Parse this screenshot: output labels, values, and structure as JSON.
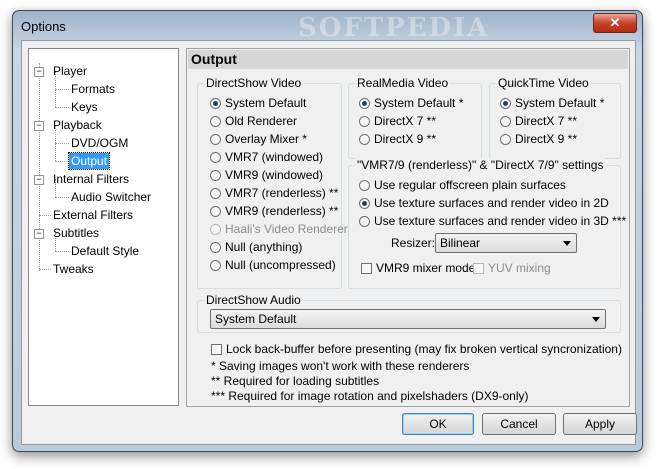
{
  "window": {
    "title": "Options",
    "watermark": "SOFTPEDIA",
    "close_glyph": "✕",
    "close_icon": "close-icon"
  },
  "tree": {
    "nodes": [
      {
        "label": "Player",
        "expanded": true
      },
      {
        "label": "Formats"
      },
      {
        "label": "Keys"
      },
      {
        "label": "Playback",
        "expanded": true
      },
      {
        "label": "DVD/OGM"
      },
      {
        "label": "Output",
        "selected": true
      },
      {
        "label": "Internal Filters",
        "expanded": true
      },
      {
        "label": "Audio Switcher"
      },
      {
        "label": "External Filters"
      },
      {
        "label": "Subtitles",
        "expanded": true
      },
      {
        "label": "Default Style"
      },
      {
        "label": "Tweaks"
      }
    ],
    "toggle_glyph": "−"
  },
  "page": {
    "title": "Output",
    "directshow_video": {
      "label": "DirectShow Video",
      "options": [
        {
          "label": "System Default",
          "checked": true
        },
        {
          "label": "Old Renderer"
        },
        {
          "label": "Overlay Mixer *"
        },
        {
          "label": "VMR7 (windowed)"
        },
        {
          "label": "VMR9 (windowed)"
        },
        {
          "label": "VMR7 (renderless) **"
        },
        {
          "label": "VMR9 (renderless) **"
        },
        {
          "label": "Haali's Video Renderer",
          "disabled": true
        },
        {
          "label": "Null (anything)"
        },
        {
          "label": "Null (uncompressed)"
        }
      ]
    },
    "realmedia_video": {
      "label": "RealMedia Video",
      "options": [
        {
          "label": "System Default *",
          "checked": true
        },
        {
          "label": "DirectX 7 **"
        },
        {
          "label": "DirectX 9 **"
        }
      ]
    },
    "quicktime_video": {
      "label": "QuickTime Video",
      "options": [
        {
          "label": "System Default *",
          "checked": true
        },
        {
          "label": "DirectX 7 **"
        },
        {
          "label": "DirectX 9 **"
        }
      ]
    },
    "vmr_settings": {
      "label": "\"VMR7/9 (renderless)\" & \"DirectX 7/9\" settings",
      "options": [
        {
          "label": "Use regular offscreen plain surfaces"
        },
        {
          "label": "Use texture surfaces and render video in 2D",
          "checked": true
        },
        {
          "label": "Use texture surfaces and render video in 3D ***"
        }
      ],
      "resizer_label": "Resizer:",
      "resizer_value": "Bilinear",
      "vmr9_mixer_label": "VMR9 mixer mode",
      "yuv_mixing_label": "YUV mixing"
    },
    "directshow_audio": {
      "label": "DirectShow Audio",
      "value": "System Default"
    },
    "lock_backbuffer_label": "Lock back-buffer before presenting (may fix broken vertical syncronization)",
    "notes": [
      "* Saving images won't work with these renderers",
      "** Required for loading subtitles",
      "*** Required for image rotation and pixelshaders (DX9-only)"
    ]
  },
  "buttons": {
    "ok": "OK",
    "cancel": "Cancel",
    "apply": "Apply"
  }
}
